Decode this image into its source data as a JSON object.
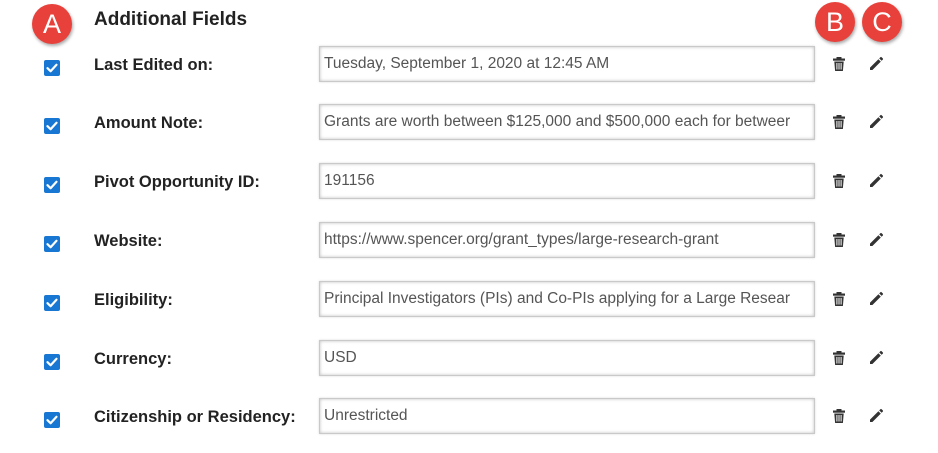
{
  "section": {
    "title": "Additional Fields"
  },
  "markers": {
    "a": "A",
    "b": "B",
    "c": "C"
  },
  "colors": {
    "marker": "#e8403a",
    "checkbox": "#1877d2"
  },
  "icons": {
    "delete": "trash-icon",
    "edit": "pencil-icon",
    "checked": "checkmark-icon"
  },
  "fields": [
    {
      "label": "Last Edited on:",
      "value": "Tuesday, September 1, 2020 at 12:45 AM",
      "checked": true
    },
    {
      "label": "Amount Note:",
      "value": "Grants are worth between $125,000 and $500,000 each for betweer",
      "checked": true
    },
    {
      "label": "Pivot Opportunity ID:",
      "value": "191156",
      "checked": true
    },
    {
      "label": "Website:",
      "value": "https://www.spencer.org/grant_types/large-research-grant",
      "checked": true
    },
    {
      "label": "Eligibility:",
      "value": "Principal Investigators (PIs) and Co-PIs applying for a Large Resear",
      "checked": true
    },
    {
      "label": "Currency:",
      "value": "USD",
      "checked": true
    },
    {
      "label": "Citizenship or Residency:",
      "value": "Unrestricted",
      "checked": true
    }
  ]
}
